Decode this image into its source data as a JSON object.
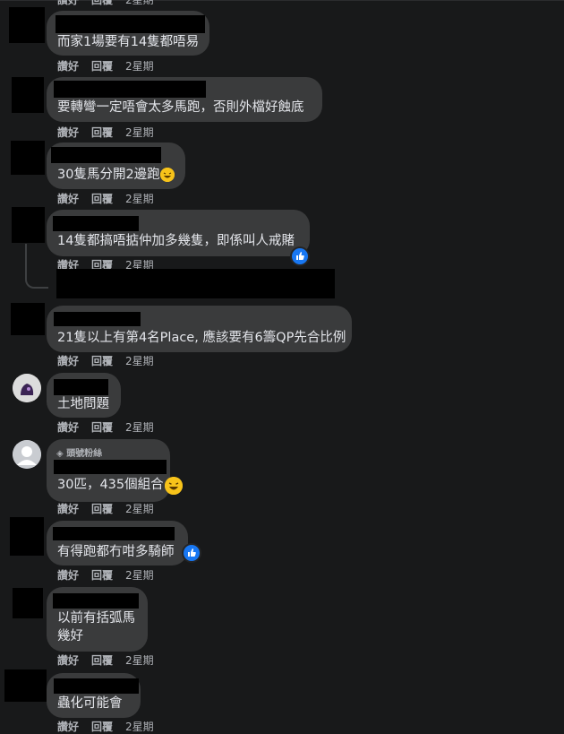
{
  "labels": {
    "like": "讚好",
    "reply": "回覆",
    "time": "2星期"
  },
  "colors": {
    "bg": "#18191a",
    "bubble": "#3a3b3c",
    "meta": "#b0b3b8",
    "text": "#e4e6eb",
    "reaction": "#1877f2"
  },
  "comments": [
    {
      "text": "而家1場要有14隻都唔易"
    },
    {
      "text": "要轉彎一定唔會太多馬跑，否則外檔好蝕底"
    },
    {
      "text": "30隻馬分開2邊跑"
    },
    {
      "text": "14隻都搞唔掂仲加多幾隻，即係叫人戒賭"
    },
    {
      "text": "21隻以上有第4名Place, 應該要有6籌QP先合比例"
    },
    {
      "text": "土地問題"
    },
    {
      "text": "30匹，435個組合",
      "badge": "頭號粉絲"
    },
    {
      "text": "有得跑都冇咁多騎師"
    },
    {
      "text_line1": "以前有括弧馬",
      "text_line2": "幾好"
    },
    {
      "text": "蟲化可能會"
    }
  ]
}
